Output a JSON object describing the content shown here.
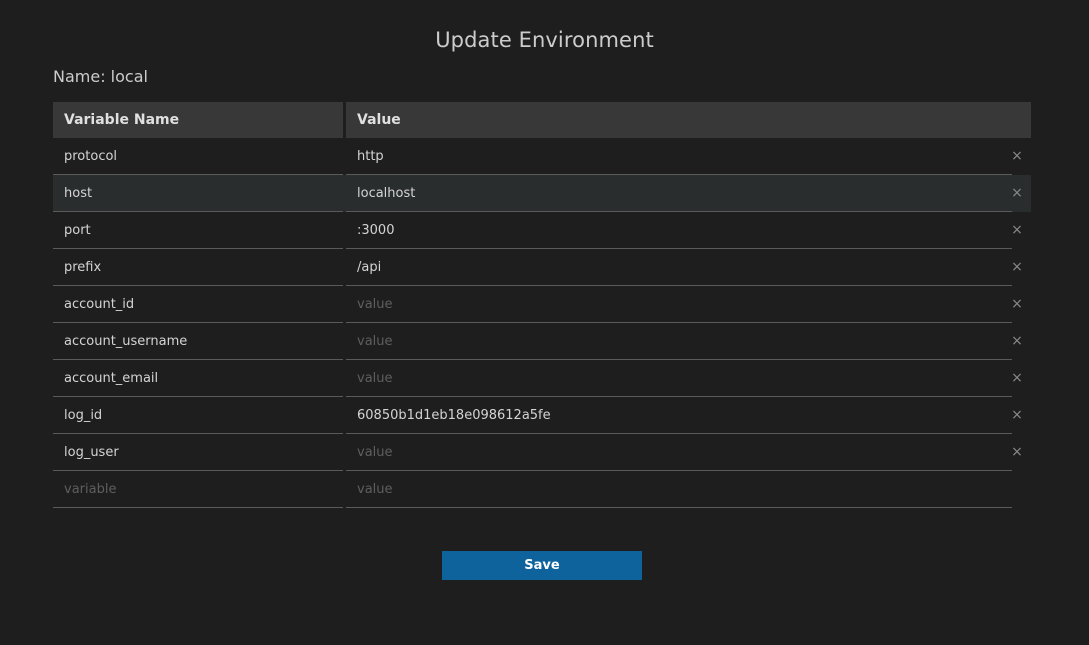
{
  "dialog": {
    "title": "Update Environment",
    "name_label": "Name: local"
  },
  "table": {
    "headers": {
      "name": "Variable Name",
      "value": "Value"
    },
    "rows": [
      {
        "name": "protocol",
        "value": "http",
        "name_placeholder": "",
        "value_placeholder": ""
      },
      {
        "name": "host",
        "value": "localhost",
        "name_placeholder": "",
        "value_placeholder": ""
      },
      {
        "name": "port",
        "value": ":3000",
        "name_placeholder": "",
        "value_placeholder": ""
      },
      {
        "name": "prefix",
        "value": "/api",
        "name_placeholder": "",
        "value_placeholder": ""
      },
      {
        "name": "account_id",
        "value": "",
        "name_placeholder": "",
        "value_placeholder": "value"
      },
      {
        "name": "account_username",
        "value": "",
        "name_placeholder": "",
        "value_placeholder": "value"
      },
      {
        "name": "account_email",
        "value": "",
        "name_placeholder": "",
        "value_placeholder": "value"
      },
      {
        "name": "log_id",
        "value": "60850b1d1eb18e098612a5fe",
        "name_placeholder": "",
        "value_placeholder": ""
      },
      {
        "name": "log_user",
        "value": "",
        "name_placeholder": "",
        "value_placeholder": "value"
      }
    ],
    "new_row": {
      "name_placeholder": "variable",
      "value_placeholder": "value"
    },
    "remove_glyph": "×"
  },
  "actions": {
    "save_label": "Save"
  },
  "colors": {
    "background": "#1e1e1e",
    "header_bg": "#383838",
    "hover_row_bg": "#2a2d2e",
    "button_bg": "#0e639c"
  }
}
